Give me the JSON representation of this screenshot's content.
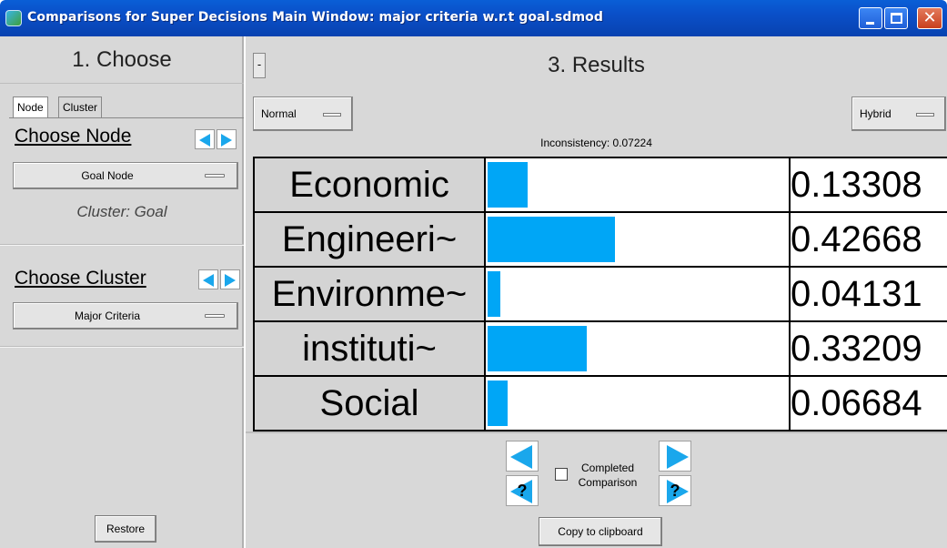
{
  "window": {
    "title": "Comparisons for Super Decisions Main Window: major criteria w.r.t goal.sdmod"
  },
  "left": {
    "heading": "1. Choose",
    "tabs": [
      "Node",
      "Cluster"
    ],
    "choose_node_label": "Choose Node",
    "node_value": "Goal Node",
    "cluster_info": "Cluster: Goal",
    "choose_cluster_label": "Choose Cluster",
    "cluster_value": "Major Criteria",
    "restore_label": "Restore"
  },
  "right": {
    "toggle_label": "-",
    "heading": "3. Results",
    "mode_left": "Normal",
    "mode_right": "Hybrid",
    "inconsistency": "Inconsistency: 0.07224",
    "completed_label": "Completed Comparison",
    "copy_label": "Copy to clipboard",
    "help_glyph": "?"
  },
  "results": [
    {
      "name": "Economic",
      "value_text": "0.13308",
      "value": 0.13308
    },
    {
      "name": "Engineeri~",
      "value_text": "0.42668",
      "value": 0.42668
    },
    {
      "name": "Environme~",
      "value_text": "0.04131",
      "value": 0.04131
    },
    {
      "name": "instituti~",
      "value_text": "0.33209",
      "value": 0.33209
    },
    {
      "name": "Social",
      "value_text": "0.06684",
      "value": 0.06684
    }
  ],
  "colors": {
    "bar_fill": "#00a6f6",
    "title_bar": "#0a4fc8",
    "panel_bg": "#d8d8d8"
  },
  "icons": [
    "window-icon",
    "minimize-icon",
    "maximize-icon",
    "close-icon",
    "prev-arrow-icon",
    "next-arrow-icon"
  ]
}
